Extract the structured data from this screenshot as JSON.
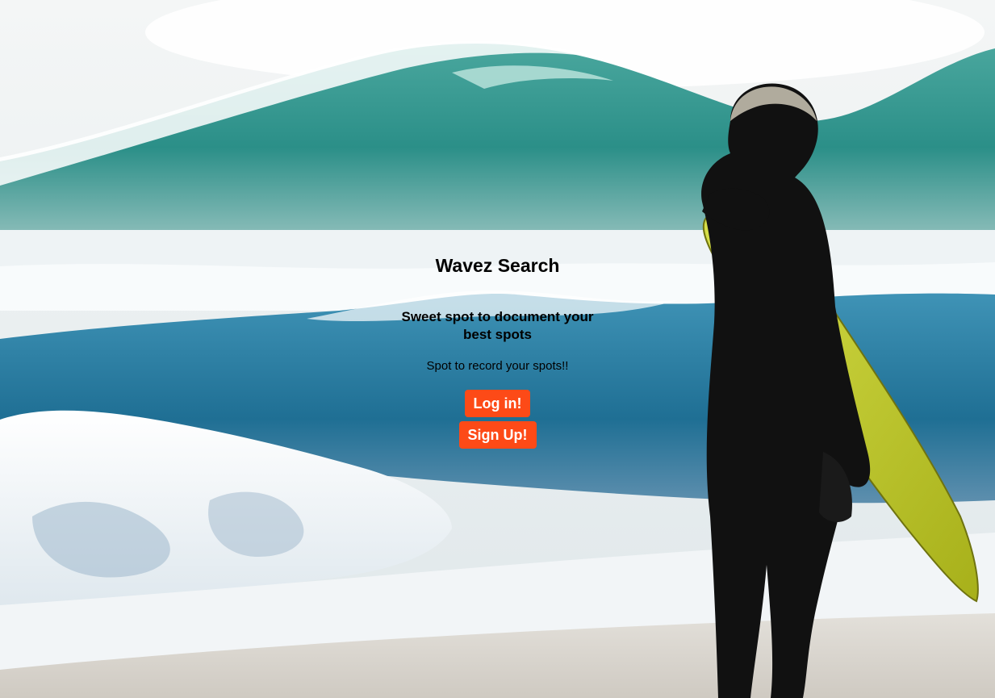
{
  "app": {
    "title": "Wavez Search",
    "tagline": "Sweet spot to document your best spots",
    "subtext": "Spot to record your spots!!"
  },
  "actions": {
    "login_label": "Log in!",
    "signup_label": "Sign Up!"
  },
  "colors": {
    "button_bg": "#fd4a17",
    "button_text": "#ffffff",
    "text": "#000000"
  },
  "background": {
    "icon": "surfer-beach-photo"
  }
}
